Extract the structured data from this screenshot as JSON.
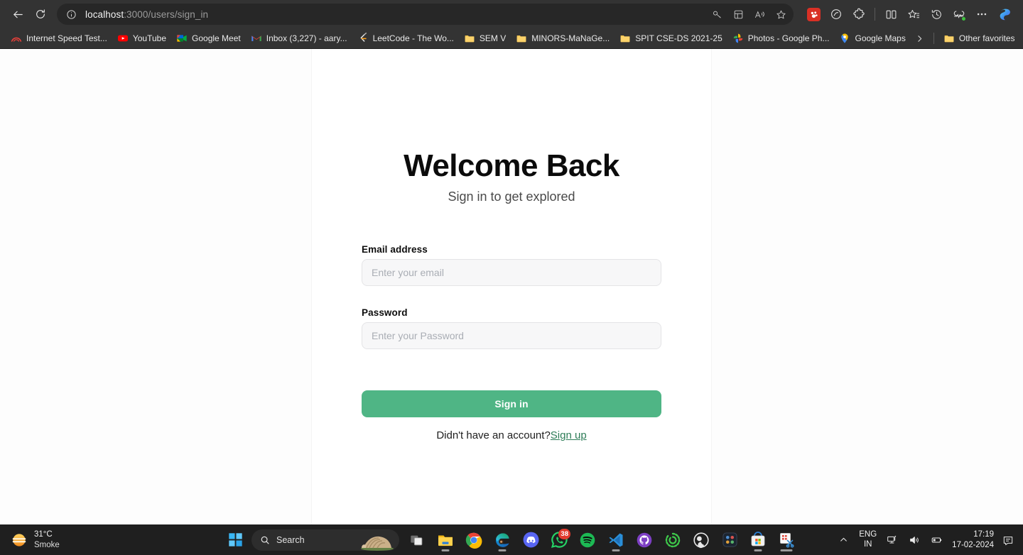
{
  "browser": {
    "nav": {
      "back_label": "Back",
      "refresh_label": "Refresh"
    },
    "address": {
      "host": "localhost",
      "path": ":3000/users/sign_in",
      "info_icon": "info-circle-icon",
      "inline_icons": [
        "key-icon",
        "collections-icon",
        "read-aloud-icon",
        "favorite-star-icon"
      ]
    },
    "extensions": [
      {
        "name": "red-extension-icon",
        "label": ""
      },
      {
        "name": "circle-extension-icon",
        "label": ""
      },
      {
        "name": "puzzle-extension-icon",
        "label": ""
      },
      {
        "name": "split-screen-icon",
        "label": ""
      },
      {
        "name": "favorites-list-icon",
        "label": ""
      },
      {
        "name": "history-icon",
        "label": ""
      },
      {
        "name": "browser-essentials-icon",
        "label": ""
      },
      {
        "name": "settings-more-icon",
        "label": ""
      },
      {
        "name": "copilot-icon",
        "label": ""
      }
    ],
    "bookmarks": [
      {
        "label": "Internet Speed Test...",
        "icon": "speedtest-icon"
      },
      {
        "label": "YouTube",
        "icon": "youtube-icon"
      },
      {
        "label": "Google Meet",
        "icon": "google-meet-icon"
      },
      {
        "label": "Inbox (3,227) - aary...",
        "icon": "gmail-icon"
      },
      {
        "label": "LeetCode - The Wo...",
        "icon": "leetcode-icon"
      },
      {
        "label": "SEM V",
        "icon": "folder-icon"
      },
      {
        "label": "MINORS-MaNaGe...",
        "icon": "folder-icon"
      },
      {
        "label": "SPIT CSE-DS 2021-25",
        "icon": "folder-icon"
      },
      {
        "label": "Photos - Google Ph...",
        "icon": "google-photos-icon"
      },
      {
        "label": "Google Maps",
        "icon": "google-maps-icon"
      }
    ],
    "bookmarks_overflow_label": "Other favorites",
    "bookmarks_overflow_icon": "chevron-right-icon"
  },
  "page": {
    "title": "Welcome Back",
    "subtitle": "Sign in to get explored",
    "fields": [
      {
        "label": "Email address",
        "placeholder": "Enter your email",
        "value": "",
        "type": "email"
      },
      {
        "label": "Password",
        "placeholder": "Enter your Password",
        "value": "",
        "type": "password"
      }
    ],
    "submit_label": "Sign in",
    "footer_text": "Didn't have an account?",
    "footer_link": "Sign up",
    "colors": {
      "accent": "#4fb585",
      "link": "#2e7d58",
      "input_bg": "#f7f7f8",
      "input_border": "#e4e4e6"
    }
  },
  "taskbar": {
    "weather": {
      "temperature": "31°C",
      "condition": "Smoke",
      "icon": "haze-sun-icon"
    },
    "start_label": "Start",
    "search_placeholder": "Search",
    "apps": [
      {
        "name": "task-view-icon",
        "badge": "",
        "running": false
      },
      {
        "name": "file-explorer-icon",
        "badge": "",
        "running": true
      },
      {
        "name": "google-chrome-icon",
        "badge": "",
        "running": false
      },
      {
        "name": "microsoft-edge-icon",
        "badge": "",
        "running": true
      },
      {
        "name": "discord-icon",
        "badge": "",
        "running": false
      },
      {
        "name": "whatsapp-icon",
        "badge": "38",
        "running": false
      },
      {
        "name": "spotify-icon",
        "badge": "",
        "running": false
      },
      {
        "name": "vs-code-icon",
        "badge": "",
        "running": true
      },
      {
        "name": "github-desktop-icon",
        "badge": "",
        "running": false
      },
      {
        "name": "obsidian-icon",
        "badge": "",
        "running": false
      },
      {
        "name": "obs-studio-icon",
        "badge": "",
        "running": false
      },
      {
        "name": "davinci-resolve-icon",
        "badge": "",
        "running": false
      },
      {
        "name": "microsoft-store-icon",
        "badge": "",
        "running": true
      },
      {
        "name": "snipping-tool-icon",
        "badge": "",
        "running": true
      }
    ],
    "tray": {
      "chevron_icon": "show-hidden-icons-chevron",
      "language": "ENG",
      "region": "IN",
      "icons": [
        "network-icon",
        "volume-icon",
        "battery-icon"
      ],
      "time": "17:19",
      "date": "17-02-2024",
      "notification_icon": "notifications-icon"
    }
  }
}
